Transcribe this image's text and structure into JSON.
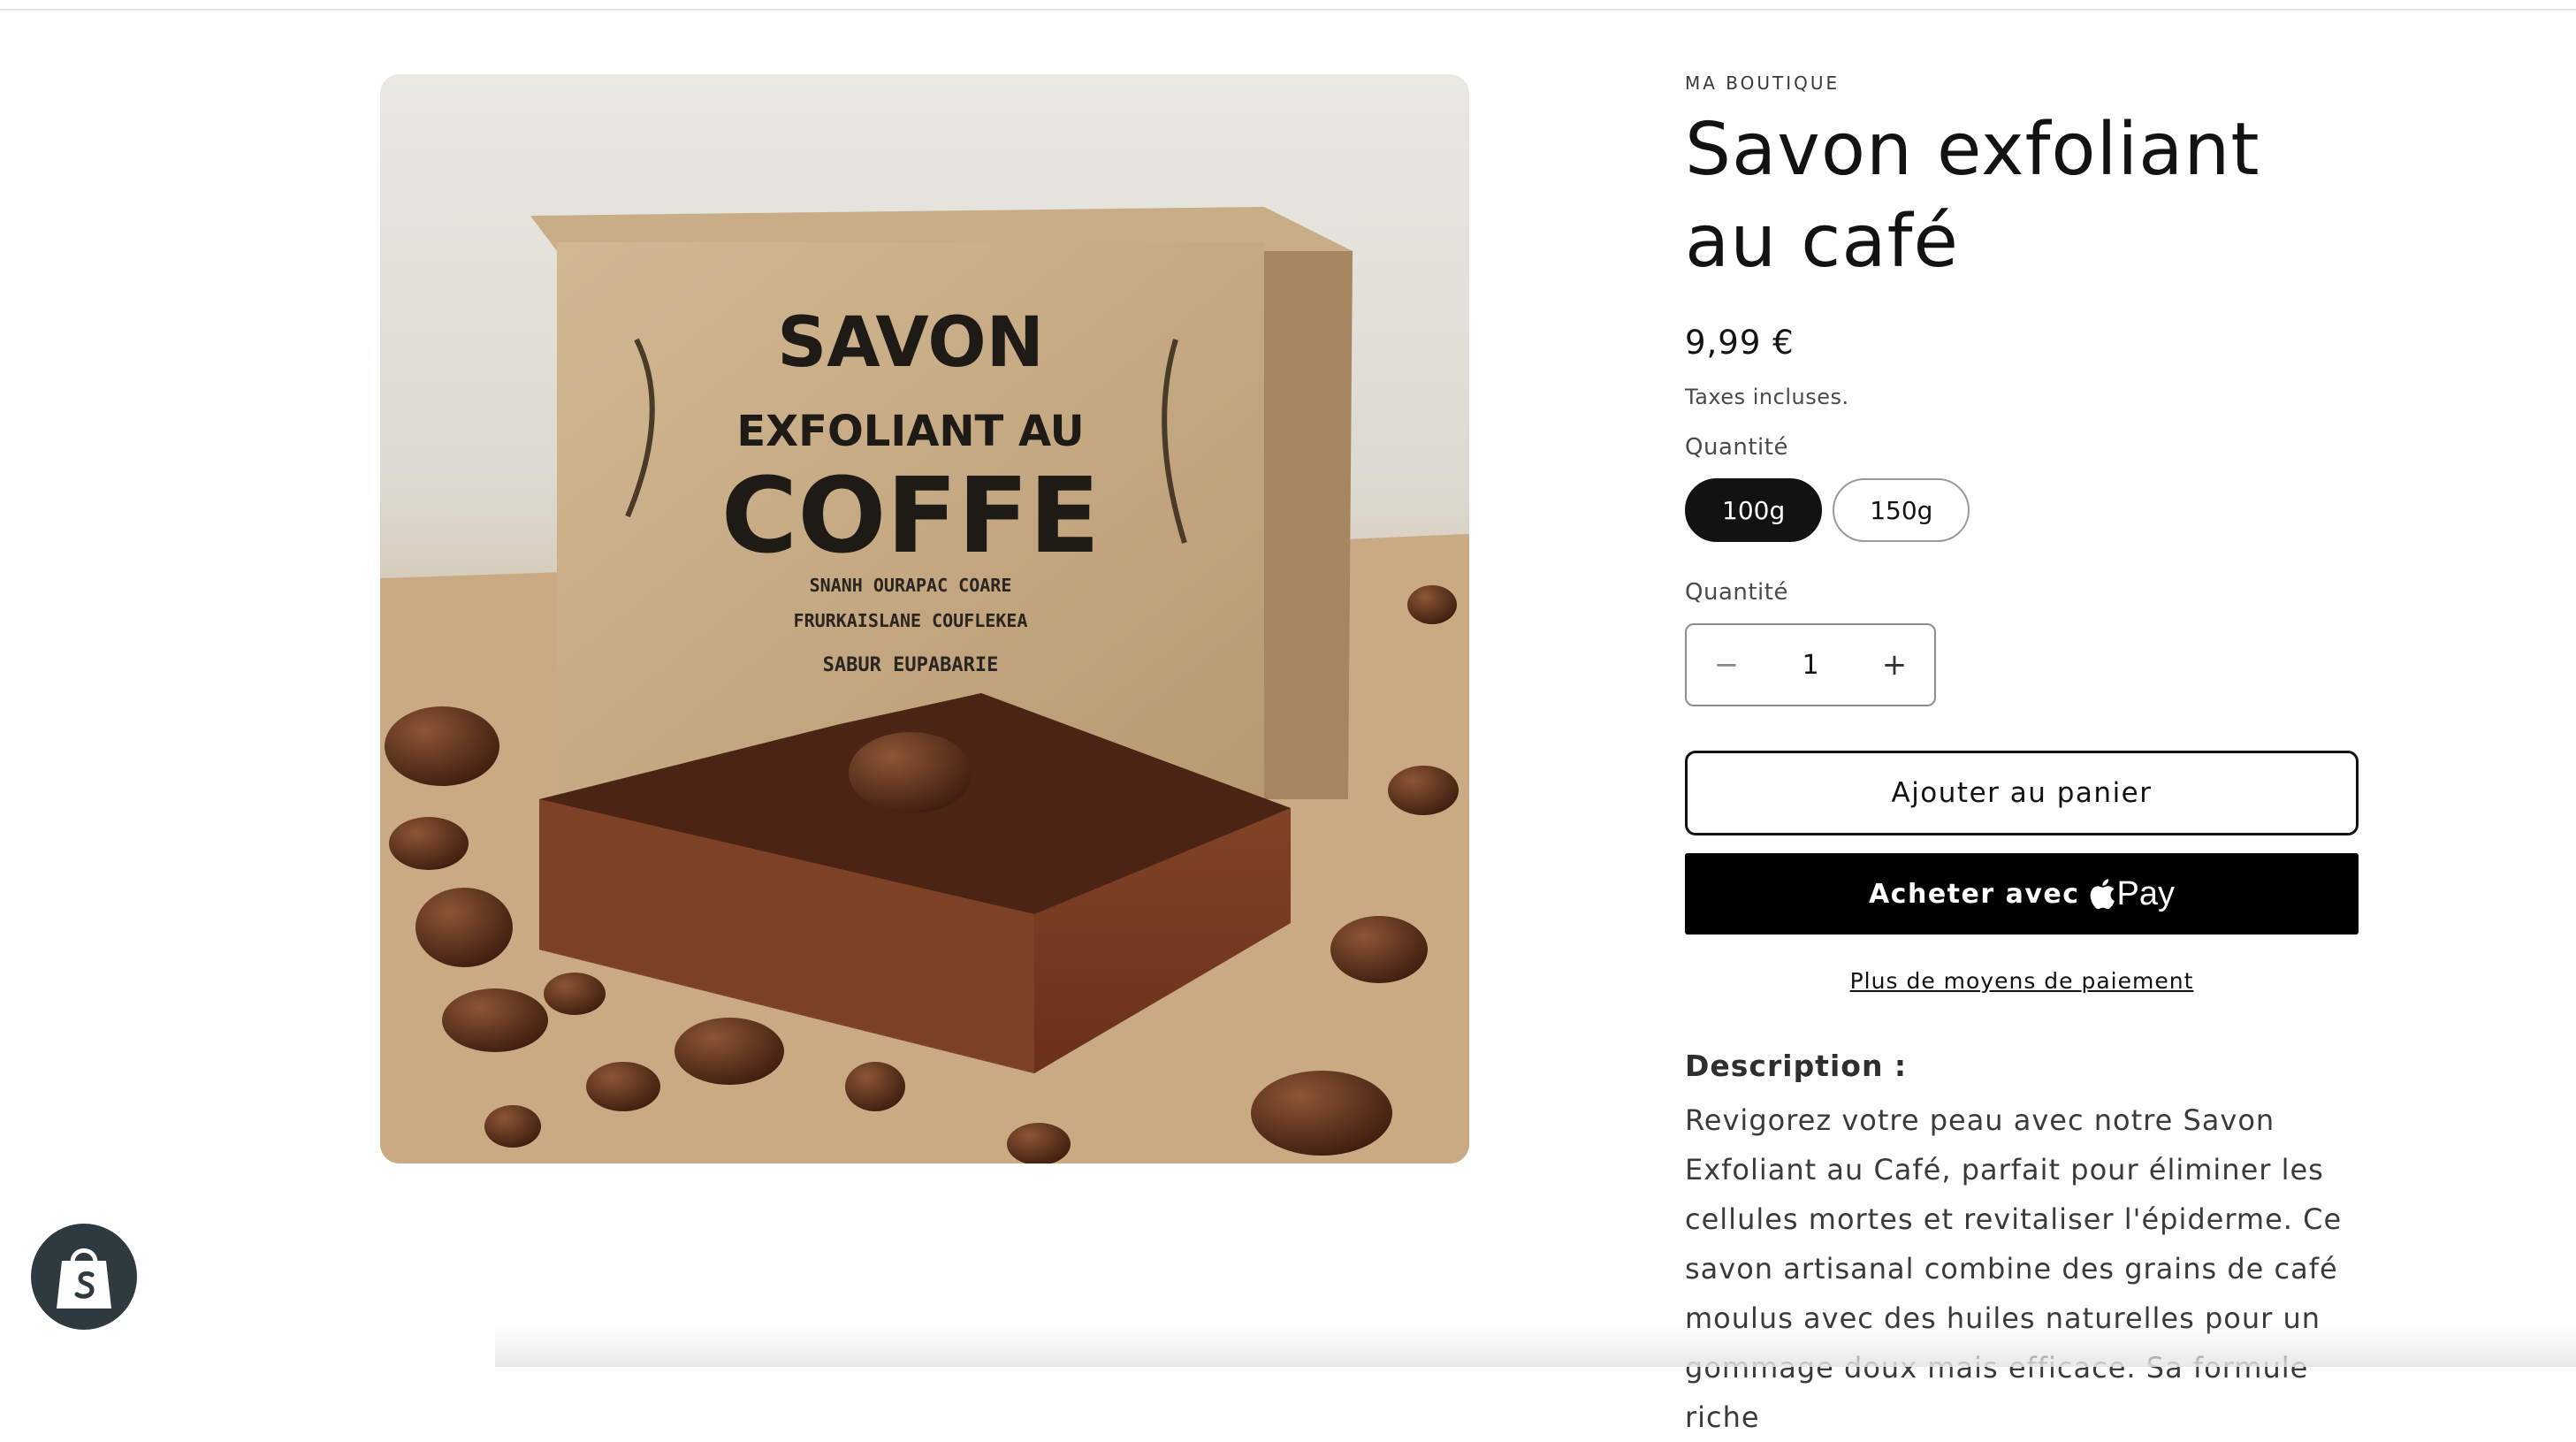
{
  "product": {
    "vendor": "MA BOUTIQUE",
    "title": "Savon exfoliant au café",
    "price": "9,99 €",
    "tax_note": "Taxes incluses.",
    "image_alt": "Savon exfoliant au café",
    "packaging_text": {
      "line1": "SAVON",
      "line2": "EXFOLIANT AU",
      "line3": "COFFE",
      "line4": "SNANH OURAPAC COARE",
      "line5": "FRURKAISLANE COUFLEKEA",
      "line6": "SABUR EUPABARIE"
    }
  },
  "variant_selector": {
    "label": "Quantité",
    "options": [
      "100g",
      "150g"
    ],
    "selected": "100g"
  },
  "quantity": {
    "label": "Quantité",
    "value": "1",
    "minus_symbol": "−",
    "plus_symbol": "+"
  },
  "actions": {
    "add_to_cart": "Ajouter au panier",
    "buy_with": "Acheter avec",
    "pay_brand": "Pay",
    "more_payment": "Plus de moyens de paiement"
  },
  "description": {
    "heading": "Description :",
    "text": "Revigorez votre peau avec notre Savon Exfoliant au Café, parfait pour éliminer les cellules mortes et revitaliser l'épiderme. Ce savon artisanal combine des grains de café moulus avec des huiles naturelles pour un gommage doux mais efficace. Sa formule riche"
  },
  "badge": {
    "icon": "shopify-bag-icon"
  },
  "colors": {
    "primary": "#121212",
    "buy_button": "#000000",
    "badge": "#2e3a3f"
  }
}
